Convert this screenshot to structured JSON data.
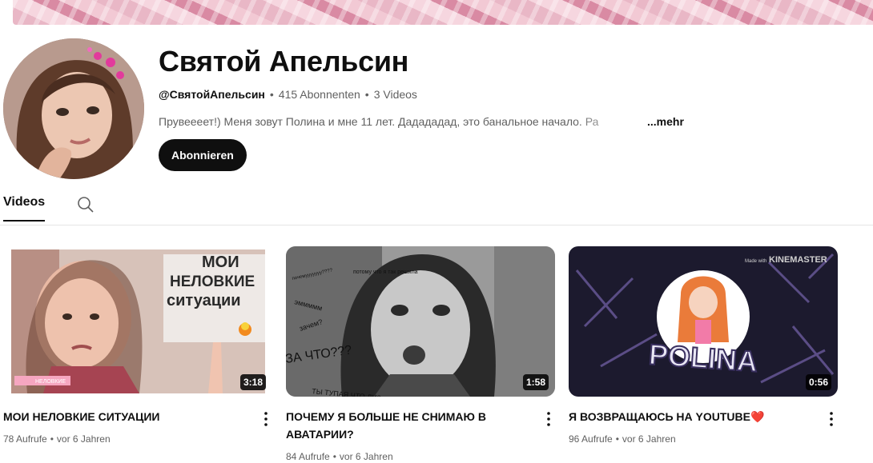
{
  "channel": {
    "name": "Святой Апельсин",
    "handle": "@СвятойАпельсин",
    "subscribers": "415 Abonnenten",
    "videos_count": "3 Videos",
    "separator": "•",
    "description": "Прувеееет!) Меня зовут Полина и мне 11 лет. Дадададад, это банальное начало. Ра",
    "more_label": "...mehr",
    "subscribe_label": "Abonnieren"
  },
  "tabs": {
    "videos_label": "Videos",
    "search_icon": "search-icon"
  },
  "videos": [
    {
      "title": "МОИ НЕЛОВКИЕ СИТУАЦИИ",
      "duration": "3:18",
      "views": "78 Aufrufe",
      "age": "vor 6 Jahren",
      "thumb_text": [
        "МОИ",
        "НЕЛОВКИЕ",
        "ситуации"
      ],
      "badge_text": "НЕЛОВКИЕ"
    },
    {
      "title": "ПОЧЕМУ Я БОЛЬШЕ НЕ СНИМАЮ В АВАТАРИИ?",
      "duration": "1:58",
      "views": "84 Aufrufe",
      "age": "vor 6 Jahren",
      "thumb_text": [
        "потому что я так решила",
        "почемууууууу????",
        "эммммм",
        "зачем?",
        "ЗА ЧТО???",
        "ТЫ ТУПАЯ ЧТО ЛИ?"
      ]
    },
    {
      "title": "Я ВОЗВРАЩАЮСЬ НА YOUTUBE",
      "title_emoji": "❤️",
      "duration": "0:56",
      "views": "96 Aufrufe",
      "age": "vor 6 Jahren",
      "thumb_text": [
        "Made with",
        "KINEMASTER",
        "POLINA"
      ]
    }
  ],
  "colors": {
    "text_primary": "#0f0f0f",
    "text_secondary": "#606060",
    "button_bg": "#0f0f0f",
    "banner_pink": "#e9b7c6"
  }
}
